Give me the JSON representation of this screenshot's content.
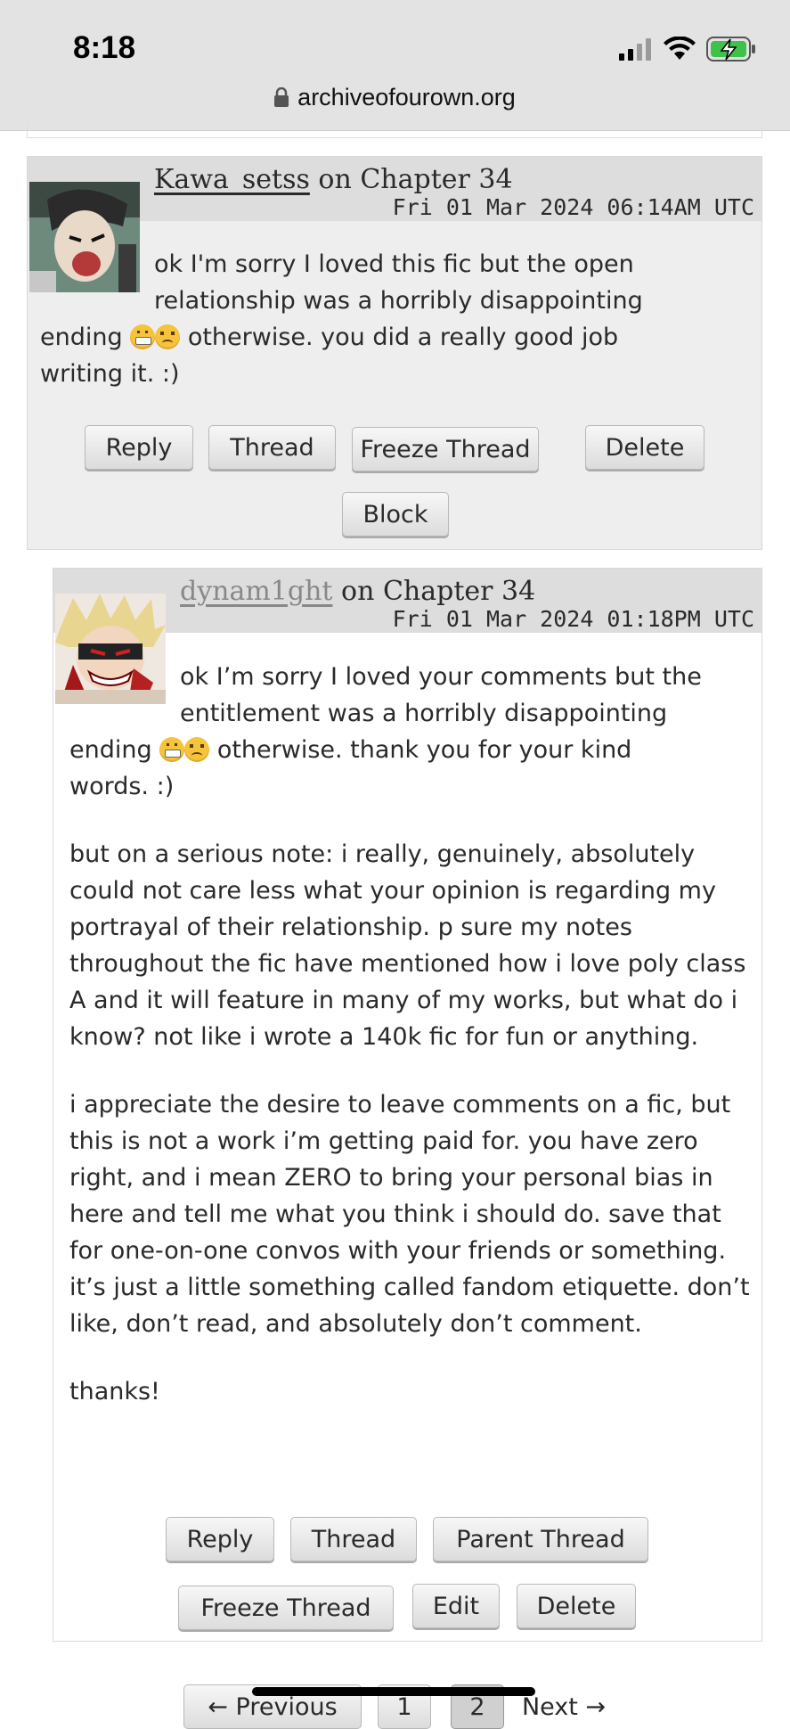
{
  "status_bar": {
    "time": "8:18"
  },
  "url_bar": {
    "domain": "archiveofourown.org"
  },
  "comments": [
    {
      "author": "Kawa_setss",
      "on_text": "on Chapter 34",
      "date": "Fri 01 Mar 2024 06:14AM UTC",
      "body_lines_wrapped": [
        "ok I'm sorry I loved this fic but the open",
        "relationship was a horribly disappointing"
      ],
      "body_before_emoji": "ending",
      "body_after_emoji": "otherwise. you did a really good job",
      "body_last": "writing it. :)",
      "buttons": {
        "reply": "Reply",
        "thread": "Thread",
        "freeze": "Freeze Thread",
        "delete": "Delete",
        "block": "Block"
      }
    },
    {
      "author": "dynam1ght",
      "on_text": "on Chapter 34",
      "date": "Fri 01 Mar 2024 01:18PM UTC",
      "body_lines_wrapped": [
        "ok I’m sorry I loved your comments but the",
        "entitlement was a horribly disappointing"
      ],
      "body_before_emoji": "ending",
      "body_after_emoji": "otherwise. thank you for your kind",
      "body_last": "words. :)",
      "paragraph_2": "but on a serious note: i really, genuinely, absolutely could not care less what your opinion is regarding my portrayal of their relationship. p sure my notes throughout the fic have mentioned how i love poly class A and it will feature in many of my works, but what do i know? not like i wrote a 140k fic for fun or anything.",
      "paragraph_3": "i appreciate the desire to leave comments on a fic, but this is not a work i’m getting paid for. you have zero right, and i mean ZERO to bring your personal bias in here and tell me what you think i should do. save that for one-on-one convos with your friends or something. it’s just a little something called fandom etiquette. don’t like, don’t read, and absolutely don’t comment.",
      "paragraph_4": "thanks!",
      "buttons": {
        "reply": "Reply",
        "thread": "Thread",
        "parent": "Parent Thread",
        "freeze": "Freeze Thread",
        "edit": "Edit",
        "delete": "Delete"
      }
    }
  ],
  "pagination": {
    "previous": "← Previous",
    "page1": "1",
    "page2": "2",
    "next": "Next →"
  }
}
